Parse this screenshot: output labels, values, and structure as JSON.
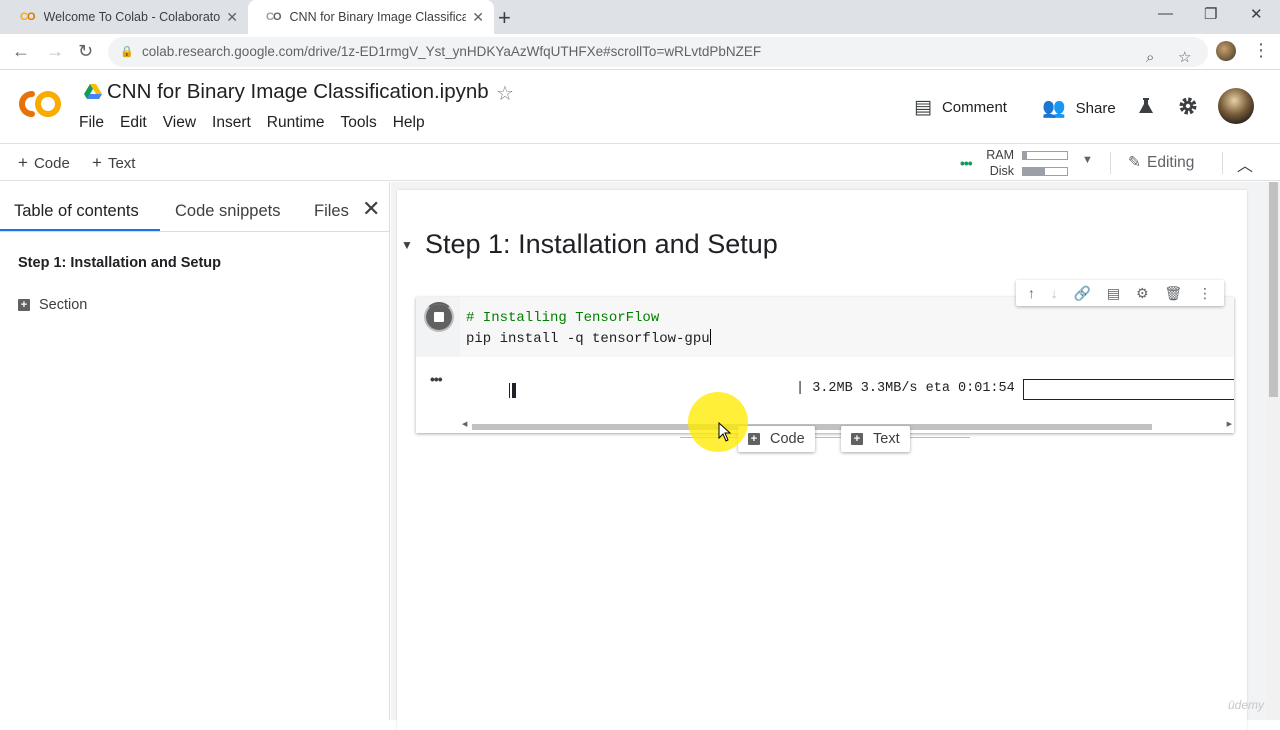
{
  "browser": {
    "tabs": [
      {
        "title": "Welcome To Colab - Colaboratory",
        "favicon": "CO"
      },
      {
        "title": "CNN for Binary Image Classification",
        "favicon": "CO"
      }
    ],
    "url": "colab.research.google.com/drive/1z-ED1rmgV_Yst_ynHDKYaAzWfqUTHFXe#scrollTo=wRLvtdPbNZEF"
  },
  "header": {
    "logo": "CO",
    "notebook_title": "CNN for Binary Image Classification.ipynb",
    "menu": [
      "File",
      "Edit",
      "View",
      "Insert",
      "Runtime",
      "Tools",
      "Help"
    ],
    "comment_label": "Comment",
    "share_label": "Share"
  },
  "toolbar": {
    "add_code": "Code",
    "add_text": "Text",
    "ram_label": "RAM",
    "disk_label": "Disk",
    "ram_fraction": 0.1,
    "disk_fraction": 0.5,
    "editing_label": "Editing"
  },
  "sidebar": {
    "tabs": [
      "Table of contents",
      "Code snippets",
      "Files"
    ],
    "toc": [
      {
        "label": "Step 1: Installation and Setup",
        "bold": true
      },
      {
        "label": "Section",
        "bold": false
      }
    ]
  },
  "notebook": {
    "heading": "Step 1: Installation and Setup",
    "cell": {
      "code_comment": "# Installing TensorFlow",
      "code_line": "pip install -q tensorflow-gpu",
      "output_stats": "| 3.2MB 3.3MB/s eta 0:01:54"
    },
    "add_code_label": "Code",
    "add_text_label": "Text"
  },
  "watermark": "ūdemy",
  "colors": {
    "accent": "#1a73e8",
    "comment_green": "#008000",
    "status_green": "#0f9d58",
    "colab_orange": "#f9ab00"
  }
}
